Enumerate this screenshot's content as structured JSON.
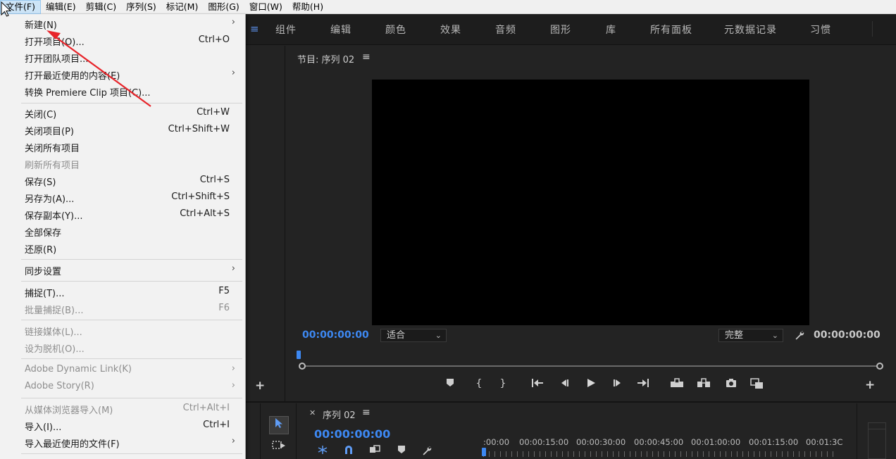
{
  "menubar": {
    "items": [
      "文件(F)",
      "编辑(E)",
      "剪辑(C)",
      "序列(S)",
      "标记(M)",
      "图形(G)",
      "窗口(W)",
      "帮助(H)"
    ]
  },
  "file_menu": {
    "items": [
      {
        "label": "新建(N)",
        "shortcut": "",
        "submenu": true,
        "disabled": false
      },
      {
        "label": "打开项目(O)...",
        "shortcut": "Ctrl+O",
        "submenu": false,
        "disabled": false
      },
      {
        "label": "打开团队项目...",
        "shortcut": "",
        "submenu": false,
        "disabled": false
      },
      {
        "label": "打开最近使用的内容(E)",
        "shortcut": "",
        "submenu": true,
        "disabled": false
      },
      {
        "label": "转换 Premiere Clip 项目(C)...",
        "shortcut": "",
        "submenu": false,
        "disabled": false
      },
      {
        "label": "关闭(C)",
        "shortcut": "Ctrl+W",
        "submenu": false,
        "disabled": false
      },
      {
        "label": "关闭项目(P)",
        "shortcut": "Ctrl+Shift+W",
        "submenu": false,
        "disabled": false
      },
      {
        "label": "关闭所有项目",
        "shortcut": "",
        "submenu": false,
        "disabled": false
      },
      {
        "label": "刷新所有项目",
        "shortcut": "",
        "submenu": false,
        "disabled": true
      },
      {
        "label": "保存(S)",
        "shortcut": "Ctrl+S",
        "submenu": false,
        "disabled": false
      },
      {
        "label": "另存为(A)...",
        "shortcut": "Ctrl+Shift+S",
        "submenu": false,
        "disabled": false
      },
      {
        "label": "保存副本(Y)...",
        "shortcut": "Ctrl+Alt+S",
        "submenu": false,
        "disabled": false
      },
      {
        "label": "全部保存",
        "shortcut": "",
        "submenu": false,
        "disabled": false
      },
      {
        "label": "还原(R)",
        "shortcut": "",
        "submenu": false,
        "disabled": false
      },
      {
        "label": "同步设置",
        "shortcut": "",
        "submenu": true,
        "disabled": false
      },
      {
        "label": "捕捉(T)...",
        "shortcut": "F5",
        "submenu": false,
        "disabled": false
      },
      {
        "label": "批量捕捉(B)...",
        "shortcut": "F6",
        "submenu": false,
        "disabled": true
      },
      {
        "label": "链接媒体(L)...",
        "shortcut": "",
        "submenu": false,
        "disabled": true
      },
      {
        "label": "设为脱机(O)...",
        "shortcut": "",
        "submenu": false,
        "disabled": true
      },
      {
        "label": "Adobe Dynamic Link(K)",
        "shortcut": "",
        "submenu": true,
        "disabled": true
      },
      {
        "label": "Adobe Story(R)",
        "shortcut": "",
        "submenu": true,
        "disabled": true
      },
      {
        "label": "从媒体浏览器导入(M)",
        "shortcut": "Ctrl+Alt+I",
        "submenu": false,
        "disabled": true
      },
      {
        "label": "导入(I)...",
        "shortcut": "Ctrl+I",
        "submenu": false,
        "disabled": false
      },
      {
        "label": "导入最近使用的文件(F)",
        "shortcut": "",
        "submenu": true,
        "disabled": false
      }
    ]
  },
  "workspaces": {
    "tabs": [
      "组件",
      "编辑",
      "颜色",
      "效果",
      "音频",
      "图形",
      "库",
      "所有面板",
      "元数据记录",
      "习惯"
    ]
  },
  "program_monitor": {
    "title": "节目: 序列 02",
    "timecode_left": "00:00:00:00",
    "timecode_right": "00:00:00:00",
    "zoom_select": "适合",
    "quality_select": "完整"
  },
  "timeline": {
    "title": "序列 02",
    "timecode": "00:00:00:00",
    "ruler_labels": [
      ":00:00",
      "00:00:15:00",
      "00:00:30:00",
      "00:00:45:00",
      "00:01:00:00",
      "00:01:15:00",
      "00:01:3C"
    ]
  },
  "colors": {
    "accent": "#3d88f2",
    "annotation_arrow": "#e8242a"
  },
  "icons": [
    "hamburger-menu-icon",
    "wrench-icon",
    "marker-icon",
    "mark-in-icon",
    "mark-out-icon",
    "go-to-in-icon",
    "step-back-icon",
    "play-icon",
    "step-forward-icon",
    "go-to-out-icon",
    "lift-icon",
    "extract-icon",
    "export-frame-icon",
    "compare-icon",
    "add-icon",
    "selection-tool-icon",
    "track-select-tool-icon",
    "snap-icon",
    "linked-selection-icon",
    "add-marker-icon",
    "settings-wrench-icon",
    "mouse-cursor-icon",
    "annotation-arrow-icon"
  ]
}
